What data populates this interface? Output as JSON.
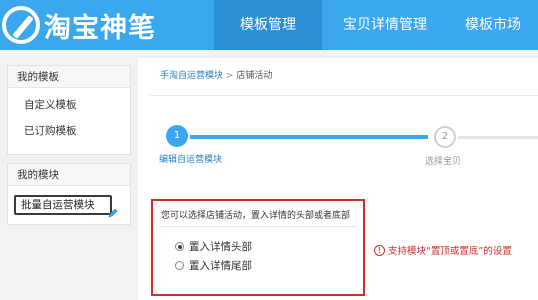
{
  "header": {
    "logo_text": "淘宝神笔",
    "nav": [
      {
        "label": "模板管理",
        "active": true
      },
      {
        "label": "宝贝详情管理",
        "active": false
      },
      {
        "label": "模板市场",
        "active": false
      }
    ]
  },
  "sidebar": {
    "my_templates": {
      "title": "我的模板",
      "items": [
        {
          "label": "自定义模板"
        },
        {
          "label": "已订购模板"
        }
      ]
    },
    "my_modules": {
      "title": "我的模块",
      "button_label": "批量自运营模块"
    }
  },
  "main": {
    "breadcrumb": {
      "parent": "手淘自运营模块",
      "separator": ">",
      "current": "店铺活动"
    },
    "steps": [
      {
        "number": "1",
        "label": "编辑自运营模块",
        "active": true
      },
      {
        "number": "2",
        "label": "选择宝贝",
        "active": false
      }
    ],
    "selection": {
      "question": "您可以选择店铺活动，置入详情的头部或者底部",
      "options": [
        {
          "label": "置入详情头部",
          "checked": true
        },
        {
          "label": "置入详情尾部",
          "checked": false
        }
      ]
    },
    "hint": {
      "icon": "!",
      "text": "支持模块“置顶或置底”的设置"
    }
  },
  "colors": {
    "header_bg": "#3aa7ef",
    "header_active": "#2b8fd6",
    "highlight_red": "#d42b2b",
    "link_blue": "#2b7fc4"
  }
}
